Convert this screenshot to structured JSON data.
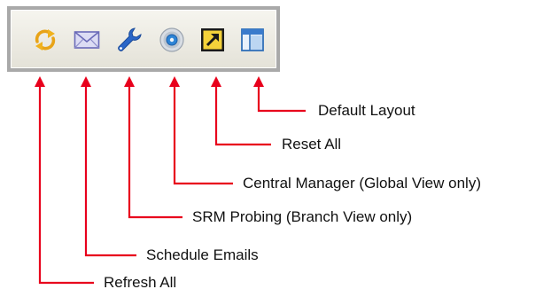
{
  "toolbar": {
    "buttons": [
      {
        "name": "refresh-all-button",
        "icon": "refresh-icon"
      },
      {
        "name": "schedule-emails-button",
        "icon": "envelope-icon"
      },
      {
        "name": "srm-probing-button",
        "icon": "wrench-icon"
      },
      {
        "name": "central-manager-button",
        "icon": "disc-icon"
      },
      {
        "name": "reset-all-button",
        "icon": "reset-arrow-icon"
      },
      {
        "name": "default-layout-button",
        "icon": "layout-icon"
      }
    ]
  },
  "callouts": {
    "default_layout": "Default Layout",
    "reset_all": "Reset All",
    "central_manager": "Central Manager (Global View only)",
    "srm_probing": "SRM Probing (Branch View only)",
    "schedule_emails": "Schedule Emails",
    "refresh_all": "Refresh All"
  },
  "colors": {
    "callout_line": "#e8001c",
    "toolbar_border": "#a9a9a9"
  }
}
